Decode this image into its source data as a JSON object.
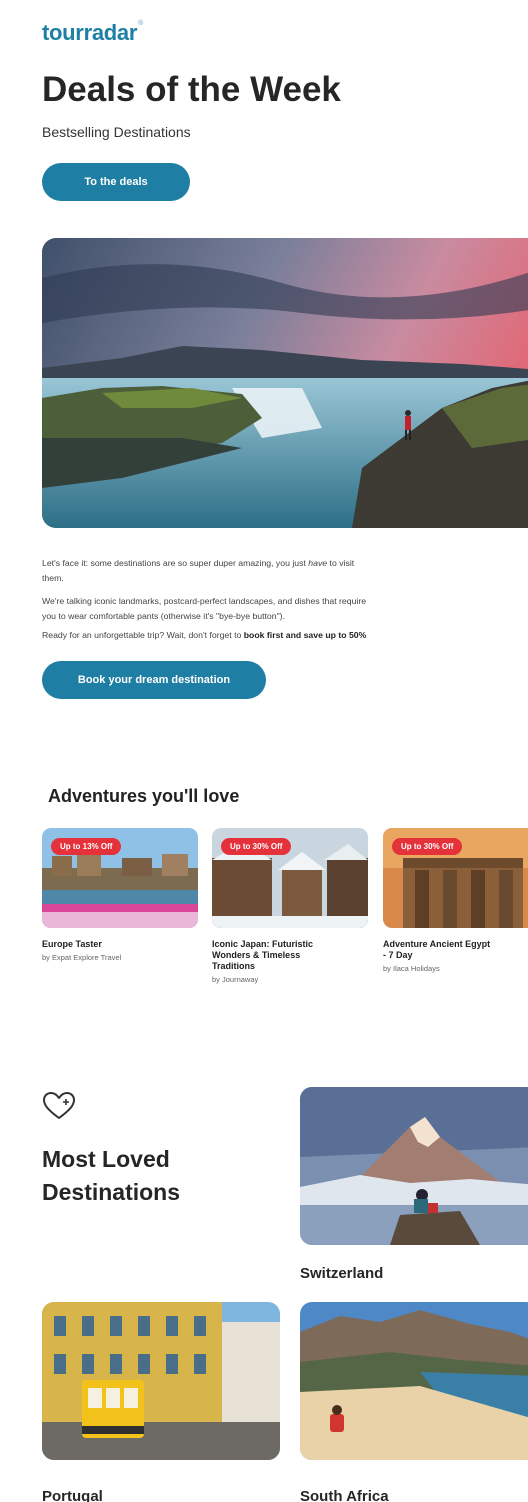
{
  "header": {
    "logo_text": "tourradar",
    "title": "Deals of the Week",
    "subtitle": "Bestselling Destinations",
    "cta_label": "To the deals"
  },
  "hero": {
    "image_icon": "waterfall-landscape-photo"
  },
  "body": {
    "p1_before": "Let's face it: some destinations are so super duper amazing, you just ",
    "p1_italic": "have",
    "p1_after": " to visit",
    "p1_line2": "them.",
    "p2_line1": "We're talking iconic landmarks, postcard-perfect landscapes, and dishes that require",
    "p2_line2": "you to wear comfortable pants (otherwise it's \"bye-bye button\").",
    "p3_before": "Ready for an unforgettable trip? Wait, don't forget to ",
    "p3_bold": "book first and save up to 50%",
    "cta_label": "Book your dream destination"
  },
  "adventures": {
    "title": "Adventures you'll love",
    "cards": [
      {
        "badge": "Up to 13% Off",
        "name_lines": [
          "Europe Taster"
        ],
        "operator": "by Expat Explore Travel"
      },
      {
        "badge": "Up to 30% Off",
        "name_lines": [
          "Iconic Japan: Futuristic",
          "Wonders & Timeless",
          "Traditions"
        ],
        "operator": "by Journaway"
      },
      {
        "badge": "Up to 30% Off",
        "name_lines": [
          "Adventure Ancient Egypt",
          "- 7 Day"
        ],
        "operator": "by Ilaca Holidays"
      }
    ]
  },
  "loved": {
    "icon": "heart-icon",
    "title_line1": "Most Loved",
    "title_line2": "Destinations",
    "destinations": [
      {
        "name": "Switzerland"
      },
      {
        "name": "Portugal"
      },
      {
        "name": "South Africa"
      }
    ]
  },
  "colors": {
    "brand": "#1f7ea3",
    "badge": "#e4313a",
    "text": "#262626"
  }
}
